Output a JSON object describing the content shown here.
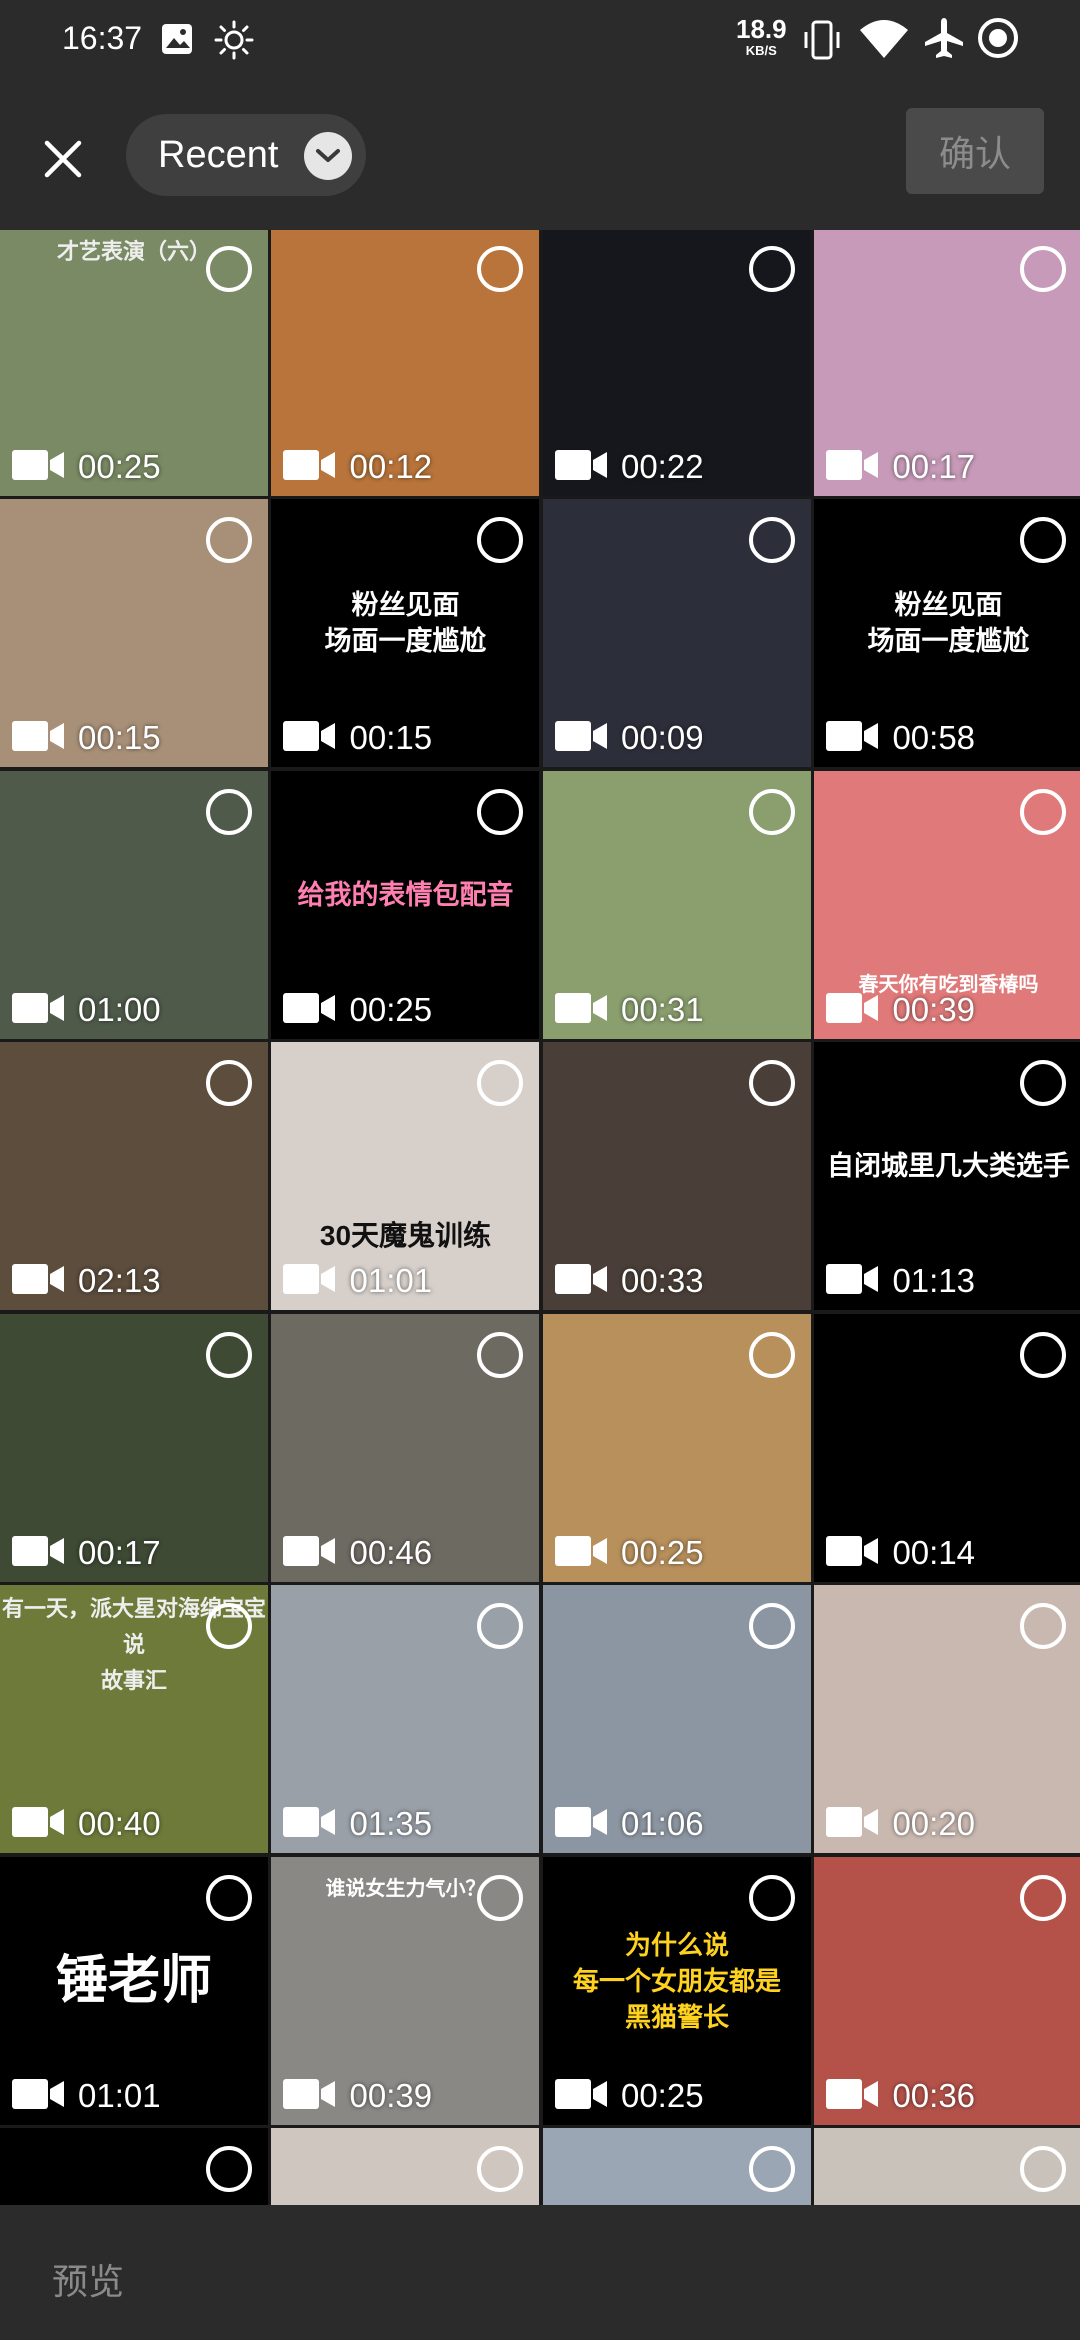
{
  "status_bar": {
    "time": "16:37",
    "net_speed_value": "18.9",
    "net_speed_unit": "KB/S",
    "icons": [
      "image-icon",
      "brightness-icon",
      "vibrate-icon",
      "wifi-icon",
      "airplane-icon",
      "record-icon"
    ]
  },
  "header": {
    "close_icon": "close-icon",
    "album_label": "Recent",
    "album_dropdown_icon": "chevron-down-icon",
    "confirm_label": "确认"
  },
  "grid": {
    "items": [
      {
        "duration": "00:25",
        "overlay": "才艺表演（六）",
        "bg": "#7a8a64"
      },
      {
        "duration": "00:12",
        "overlay": "",
        "bg": "#b8743a"
      },
      {
        "duration": "00:22",
        "overlay": "",
        "bg": "#15171d"
      },
      {
        "duration": "00:17",
        "overlay": "",
        "bg": "#c69ab8"
      },
      {
        "duration": "00:15",
        "overlay": "",
        "bg": "#a89078"
      },
      {
        "duration": "00:15",
        "overlay": "粉丝见面\n场面一度尴尬",
        "bg": "#000000"
      },
      {
        "duration": "00:09",
        "overlay": "",
        "bg": "#2c2f3a"
      },
      {
        "duration": "00:58",
        "overlay": "粉丝见面\n场面一度尴尬",
        "bg": "#000000"
      },
      {
        "duration": "01:00",
        "overlay": "",
        "bg": "#4f5a4a"
      },
      {
        "duration": "00:25",
        "overlay": "给我的表情包配音",
        "bg": "#000000"
      },
      {
        "duration": "00:31",
        "overlay": "",
        "bg": "#8a9e6e"
      },
      {
        "duration": "00:39",
        "overlay": "春天你有吃到香椿吗",
        "bg": "#e07a7a"
      },
      {
        "duration": "02:13",
        "overlay": "",
        "bg": "#5c4d3d"
      },
      {
        "duration": "01:01",
        "overlay": "30天魔鬼训练",
        "bg": "#d6cfca"
      },
      {
        "duration": "00:33",
        "overlay": "",
        "bg": "#4a3f38"
      },
      {
        "duration": "01:13",
        "overlay": "自闭城里几大类选手",
        "bg": "#000000"
      },
      {
        "duration": "00:17",
        "overlay": "",
        "bg": "#3e4a34"
      },
      {
        "duration": "00:46",
        "overlay": "",
        "bg": "#6d6a62"
      },
      {
        "duration": "00:25",
        "overlay": "",
        "bg": "#b8905c"
      },
      {
        "duration": "00:14",
        "overlay": "",
        "bg": "#000000"
      },
      {
        "duration": "00:40",
        "overlay": "有一天，派大星对海绵宝宝说\n故事汇",
        "bg": "#6e7a3a"
      },
      {
        "duration": "01:35",
        "overlay": "",
        "bg": "#9aa0a8"
      },
      {
        "duration": "01:06",
        "overlay": "",
        "bg": "#8c96a2"
      },
      {
        "duration": "00:20",
        "overlay": "",
        "bg": "#c9b8b0"
      },
      {
        "duration": "01:01",
        "overlay": "锤老师",
        "bg": "#000000"
      },
      {
        "duration": "00:39",
        "overlay": "谁说女生力气小？",
        "bg": "#8a8884"
      },
      {
        "duration": "00:25",
        "overlay": "为什么说\n每一个女朋友都是\n黑猫警长",
        "bg": "#000000"
      },
      {
        "duration": "00:36",
        "overlay": "",
        "bg": "#b4524a"
      },
      {
        "duration": "",
        "overlay": "",
        "bg": "#000000"
      },
      {
        "duration": "",
        "overlay": "",
        "bg": "#d0c6c0"
      },
      {
        "duration": "",
        "overlay": "",
        "bg": "#9aa6b4"
      },
      {
        "duration": "",
        "overlay": "",
        "bg": "#c8c2ba"
      }
    ]
  },
  "bottom_bar": {
    "preview_label": "预览"
  }
}
